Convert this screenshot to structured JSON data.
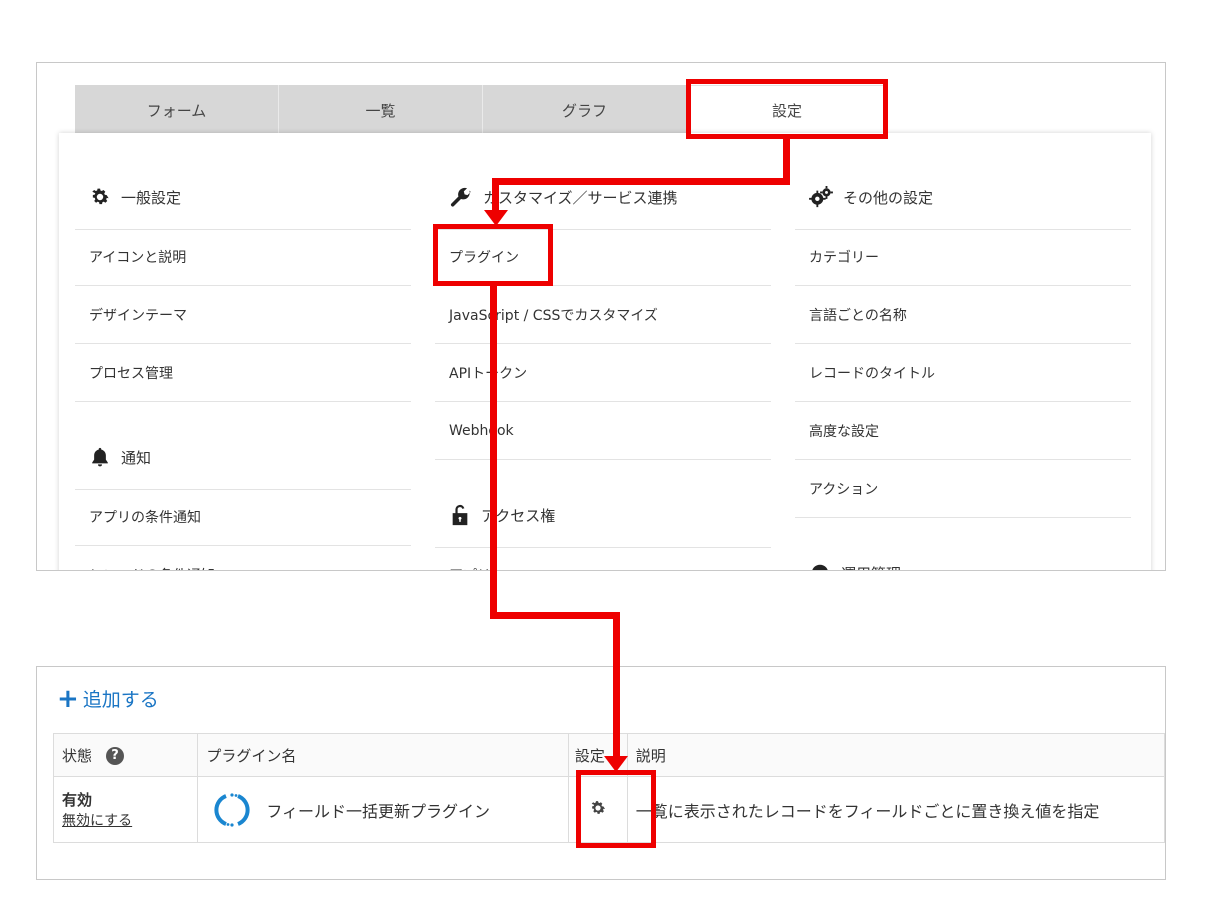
{
  "tabs": [
    "フォーム",
    "一覧",
    "グラフ",
    "設定"
  ],
  "general": {
    "title": "一般設定",
    "items": [
      "アイコンと説明",
      "デザインテーマ",
      "プロセス管理"
    ]
  },
  "notify": {
    "title": "通知",
    "items": [
      "アプリの条件通知",
      "レコードの条件通知"
    ]
  },
  "customize": {
    "title": "カスタマイズ／サービス連携",
    "items": [
      "プラグイン",
      "JavaScript / CSSでカスタマイズ",
      "APIトークン",
      "Webhook"
    ]
  },
  "access": {
    "title": "アクセス権",
    "items": [
      "アプリ"
    ]
  },
  "other": {
    "title": "その他の設定",
    "items": [
      "カテゴリー",
      "言語ごとの名称",
      "レコードのタイトル",
      "高度な設定",
      "アクション"
    ]
  },
  "ops": {
    "title": "運用管理"
  },
  "plugins": {
    "add_label": "追加する",
    "headers": {
      "status": "状態",
      "name": "プラグイン名",
      "settings": "設定",
      "description": "説明"
    },
    "help_glyph": "?",
    "rows": [
      {
        "status": "有効",
        "toggle_label": "無効にする",
        "name": "フィールド一括更新プラグイン",
        "description": "一覧に表示されたレコードをフィールドごとに置き換え値を指定"
      }
    ]
  },
  "colors": {
    "highlight": "#ee0000",
    "link": "#1a75c4",
    "tab_inactive": "#d7d7d7"
  },
  "icons": [
    "gear-icon",
    "bell-icon",
    "wrench-icon",
    "lock-icon",
    "gears-icon",
    "plus-icon",
    "refresh-icon",
    "help-icon"
  ]
}
